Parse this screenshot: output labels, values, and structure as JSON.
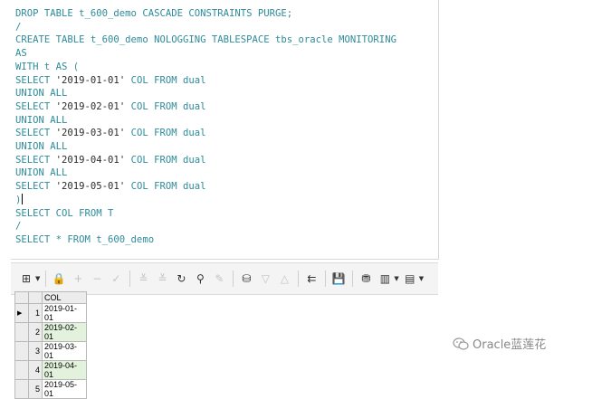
{
  "editor": {
    "lines": [
      [
        {
          "t": "DROP TABLE t_600_demo CASCADE CONSTRAINTS PURGE;",
          "c": "kw"
        }
      ],
      [
        {
          "t": "/",
          "c": "kw"
        }
      ],
      [
        {
          "t": "CREATE TABLE t_600_demo NOLOGGING TABLESPACE tbs_oracle MONITORING",
          "c": "kw"
        }
      ],
      [
        {
          "t": "AS",
          "c": "kw"
        }
      ],
      [
        {
          "t": "WITH t AS (",
          "c": "kw"
        }
      ],
      [
        {
          "t": "SELECT ",
          "c": "kw"
        },
        {
          "t": "'2019-01-01'",
          "c": "st"
        },
        {
          "t": " COL FROM dual",
          "c": "kw"
        }
      ],
      [
        {
          "t": "UNION ALL",
          "c": "kw"
        }
      ],
      [
        {
          "t": "SELECT ",
          "c": "kw"
        },
        {
          "t": "'2019-02-01'",
          "c": "st"
        },
        {
          "t": " COL FROM dual",
          "c": "kw"
        }
      ],
      [
        {
          "t": "UNION ALL",
          "c": "kw"
        }
      ],
      [
        {
          "t": "SELECT ",
          "c": "kw"
        },
        {
          "t": "'2019-03-01'",
          "c": "st"
        },
        {
          "t": " COL FROM dual",
          "c": "kw"
        }
      ],
      [
        {
          "t": "UNION ALL",
          "c": "kw"
        }
      ],
      [
        {
          "t": "SELECT ",
          "c": "kw"
        },
        {
          "t": "'2019-04-01'",
          "c": "st"
        },
        {
          "t": " COL FROM dual",
          "c": "kw"
        }
      ],
      [
        {
          "t": "UNION ALL",
          "c": "kw"
        }
      ],
      [
        {
          "t": "SELECT ",
          "c": "kw"
        },
        {
          "t": "'2019-05-01'",
          "c": "st"
        },
        {
          "t": " COL FROM dual",
          "c": "kw"
        }
      ],
      [
        {
          "t": ")",
          "c": "kw",
          "cursor": true
        }
      ],
      [
        {
          "t": "SELECT COL FROM T",
          "c": "kw"
        }
      ],
      [
        {
          "t": "/",
          "c": "kw"
        }
      ],
      [
        {
          "t": "SELECT * FROM t_600_demo",
          "c": "kw"
        }
      ]
    ]
  },
  "toolbar": {
    "buttons": [
      {
        "name": "grid-view-icon",
        "glyph": "⊞",
        "caret": true,
        "dis": false
      },
      {
        "name": "sep"
      },
      {
        "name": "lock-icon",
        "glyph": "🔒",
        "dis": false
      },
      {
        "name": "insert-record-icon",
        "glyph": "+",
        "dis": true
      },
      {
        "name": "delete-record-icon",
        "glyph": "−",
        "dis": true
      },
      {
        "name": "post-edit-icon",
        "glyph": "✓",
        "dis": true
      },
      {
        "name": "sep"
      },
      {
        "name": "query-by-example-icon",
        "glyph": "≚",
        "dis": true
      },
      {
        "name": "clear-query-icon",
        "glyph": "≚",
        "dis": true
      },
      {
        "name": "refresh-icon",
        "glyph": "↻",
        "dis": false
      },
      {
        "name": "find-icon",
        "glyph": "⚲",
        "dis": false
      },
      {
        "name": "clear-icon",
        "glyph": "✎",
        "dis": true
      },
      {
        "name": "sep"
      },
      {
        "name": "filter-icon",
        "glyph": "⛁",
        "dis": false
      },
      {
        "name": "sort-desc-icon",
        "glyph": "▽",
        "dis": true
      },
      {
        "name": "sort-asc-icon",
        "glyph": "△",
        "dis": true
      },
      {
        "name": "sep"
      },
      {
        "name": "link-columns-icon",
        "glyph": "⇇",
        "dis": false
      },
      {
        "name": "sep"
      },
      {
        "name": "save-icon",
        "glyph": "💾",
        "dis": false
      },
      {
        "name": "sep"
      },
      {
        "name": "export-icon",
        "glyph": "⛃",
        "dis": false
      },
      {
        "name": "chart-icon",
        "glyph": "▥",
        "caret": true,
        "dis": false
      },
      {
        "name": "table-icon",
        "glyph": "▤",
        "caret": true,
        "dis": false
      }
    ]
  },
  "results": {
    "column": "COL",
    "rows": [
      "2019-01-01",
      "2019-02-01",
      "2019-03-01",
      "2019-04-01",
      "2019-05-01"
    ]
  },
  "watermark": {
    "text": "Oracle蓝莲花"
  },
  "colors": {
    "keyword": "#2e8b9a",
    "grid_alt_row": "#e2f2dc"
  }
}
